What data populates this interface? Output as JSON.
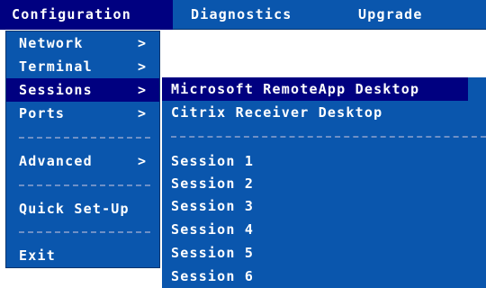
{
  "menubar": {
    "items": [
      "Configuration",
      "Diagnostics",
      "Upgrade"
    ]
  },
  "config_menu": {
    "items": [
      {
        "label": "Network",
        "arrow": ">"
      },
      {
        "label": "Terminal",
        "arrow": ">"
      },
      {
        "label": "Sessions",
        "arrow": ">"
      },
      {
        "label": "Ports",
        "arrow": ">"
      },
      {
        "label": "Advanced",
        "arrow": ">"
      },
      {
        "label": "Quick Set-Up"
      },
      {
        "label": "Exit"
      }
    ],
    "selected": "Sessions"
  },
  "sessions_menu": {
    "items": [
      "Microsoft RemoteApp Desktop",
      "Citrix Receiver Desktop",
      "Session 1",
      "Session 2",
      "Session 3",
      "Session 4",
      "Session 5",
      "Session 6"
    ],
    "selected": "Microsoft RemoteApp Desktop"
  },
  "colors": {
    "menu_background": "#0a56ad",
    "selection": "#000080",
    "text": "#ffffff",
    "separator": "#6e90c6"
  }
}
